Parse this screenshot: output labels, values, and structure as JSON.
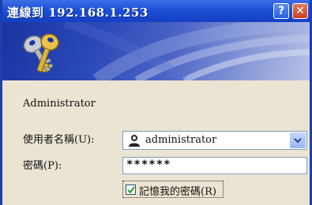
{
  "titlebar": {
    "title": "連線到 192.168.1.253",
    "help_glyph": "?",
    "close_glyph": "✕"
  },
  "form": {
    "server_label": "Administrator",
    "user_label": "使用者名稱(U):",
    "user_value": "administrator",
    "password_label": "密碼(P):",
    "password_value": "******",
    "remember_label": "記憶我的密碼(R)",
    "remember_checked": true
  },
  "icons": {
    "banner": "keys-icon",
    "user": "user-icon",
    "dropdown": "chevron-down-icon",
    "check": "checkmark-icon"
  },
  "colors": {
    "titlebar": "#1c4fd6",
    "banner": "#2a48b8",
    "close_button": "#c8401f",
    "dialog_bg": "#ebe4d3"
  }
}
